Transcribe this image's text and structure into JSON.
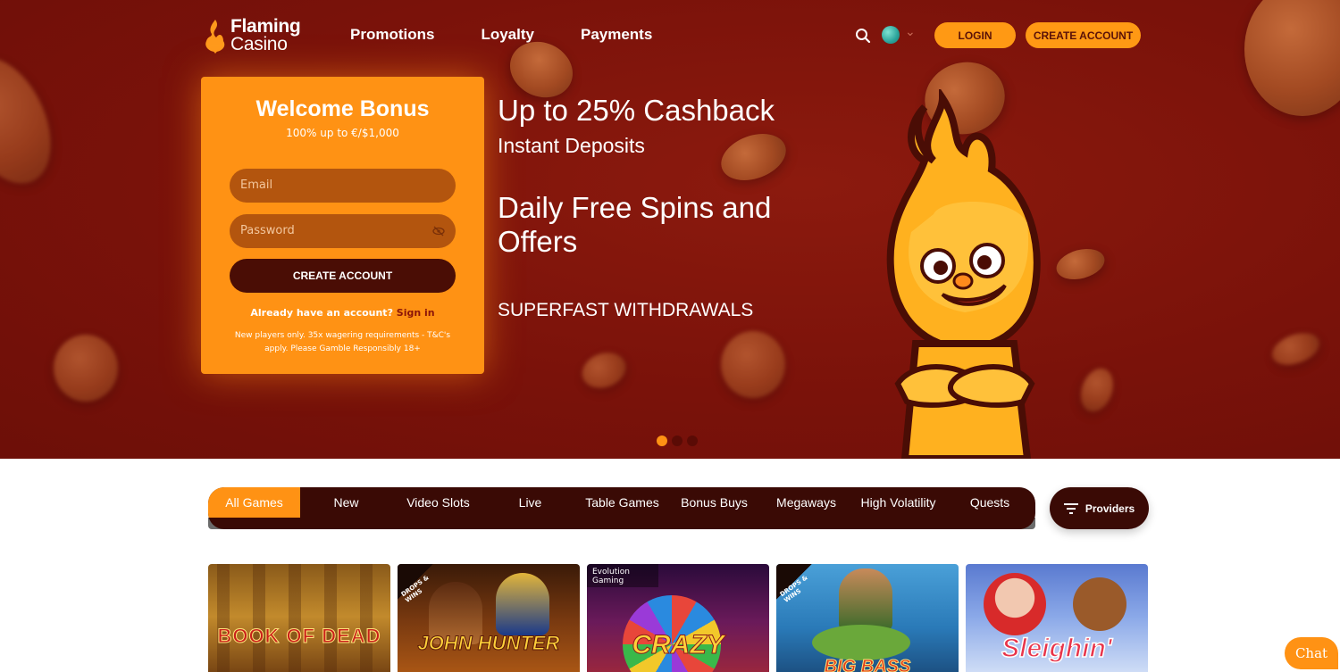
{
  "header": {
    "logo_line1": "Flaming",
    "logo_line2": "Casino",
    "nav": [
      "Promotions",
      "Loyalty",
      "Payments"
    ],
    "login_label": "LOGIN",
    "create_label": "CREATE ACCOUNT"
  },
  "signup": {
    "title": "Welcome Bonus",
    "subtitle": "100% up to €/$1,000",
    "email_placeholder": "Email",
    "password_placeholder": "Password",
    "submit_label": "CREATE ACCOUNT",
    "already_text": "Already have an account?",
    "signin_link": "Sign in",
    "terms": "New players only. 35x wagering requirements - T&C's apply. Please Gamble Responsibly 18+"
  },
  "hero": {
    "headline": "Up to 25% Cashback",
    "subheadline": "Instant Deposits",
    "offer": "Daily Free Spins and Offers",
    "tagline": "SUPERFAST WITHDRAWALS",
    "slides_total": 3,
    "slide_active": 1
  },
  "games": {
    "tabs": [
      "All Games",
      "New",
      "Video Slots",
      "Live",
      "Table Games",
      "Bonus Buys",
      "Megaways",
      "High Volatility",
      "Quests"
    ],
    "active_tab": "All Games",
    "providers_label": "Providers",
    "tiles": [
      {
        "title": "BOOK OF DEAD",
        "badge": ""
      },
      {
        "title": "JOHN HUNTER",
        "badge": "DROPS & WINS"
      },
      {
        "title": "CRAZY",
        "badge": "Evolution Gaming"
      },
      {
        "title": "BIG BASS",
        "badge": "DROPS & WINS"
      },
      {
        "title": "Sleighin'",
        "badge": ""
      }
    ]
  },
  "chat": {
    "label": "Chat"
  },
  "colors": {
    "primary": "#ff9214",
    "hero_bg": "#7a120a",
    "dark": "#3a0a05"
  }
}
